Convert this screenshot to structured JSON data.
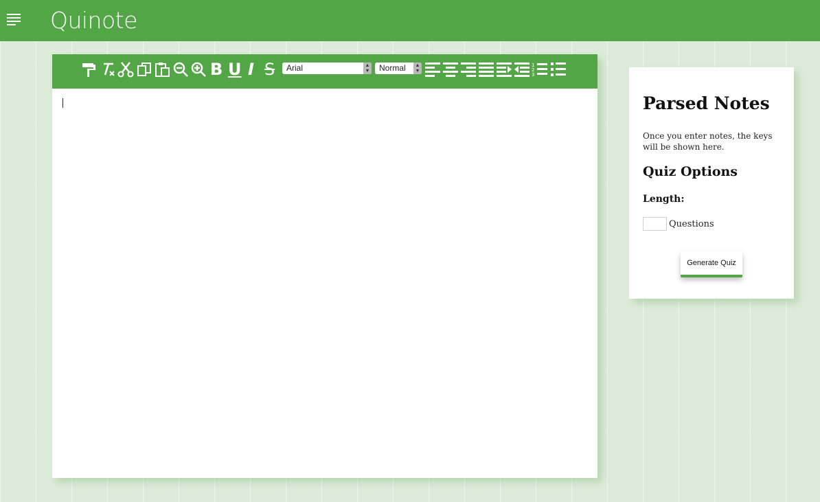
{
  "header": {
    "app_name": "Quinote",
    "menu_icon": "hamburger-menu-icon"
  },
  "colors": {
    "brand": "#52a645",
    "background": "#dcecd9"
  },
  "toolbar": {
    "icons": [
      "paint-roller-icon",
      "clear-formatting-icon",
      "cut-icon",
      "copy-icon",
      "paste-icon",
      "zoom-out-icon",
      "zoom-in-icon",
      "bold-icon",
      "underline-icon",
      "italic-icon",
      "strikethrough-icon",
      "align-left-icon",
      "align-center-icon",
      "align-right-icon",
      "justify-icon",
      "indent-icon",
      "outdent-icon",
      "numbered-list-icon",
      "bullet-list-icon"
    ],
    "bold_glyph": "B",
    "underline_glyph": "U",
    "italic_glyph": "I",
    "strike_glyph": "S",
    "font_select": {
      "value": "Arial"
    },
    "size_select": {
      "value": "Normal"
    }
  },
  "editor": {
    "content": ""
  },
  "panel": {
    "title": "Parsed Notes",
    "note": "Once you enter notes, the keys will be shown here.",
    "quiz_heading": "Quiz Options",
    "length_label": "Length:",
    "questions_value": "",
    "questions_label": "Questions",
    "generate_label": "Generate Quiz"
  }
}
